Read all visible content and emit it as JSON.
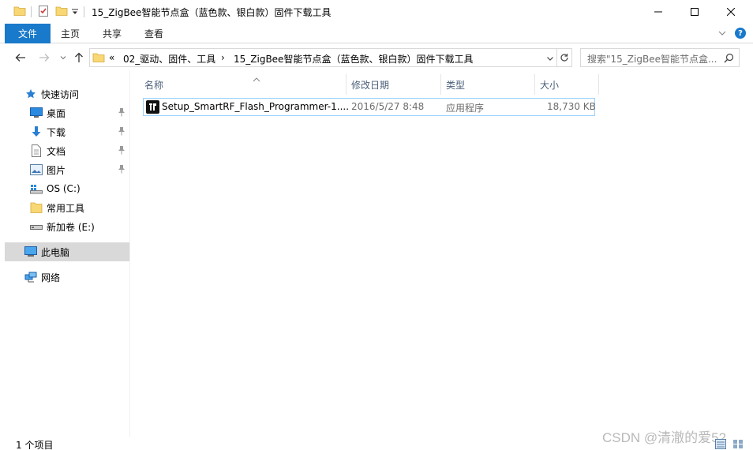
{
  "window": {
    "title": "15_ZigBee智能节点盒（蓝色款、银白款）固件下载工具"
  },
  "ribbon": {
    "tabs": [
      {
        "label": "文件"
      },
      {
        "label": "主页"
      },
      {
        "label": "共享"
      },
      {
        "label": "查看"
      }
    ],
    "help": "?"
  },
  "address": {
    "overflow": "«",
    "path": [
      {
        "label": "02_驱动、固件、工具"
      },
      {
        "label": "15_ZigBee智能节点盒（蓝色款、银白款）固件下载工具"
      }
    ],
    "search_placeholder": "搜索\"15_ZigBee智能节点盒..."
  },
  "navigation": {
    "quick_access": "快速访问",
    "items": [
      {
        "label": "桌面",
        "icon": "desktop-icon",
        "pinned": true
      },
      {
        "label": "下载",
        "icon": "download-icon",
        "pinned": true
      },
      {
        "label": "文档",
        "icon": "document-icon",
        "pinned": true
      },
      {
        "label": "图片",
        "icon": "picture-icon",
        "pinned": true
      },
      {
        "label": "OS (C:)",
        "icon": "drive-icon",
        "pinned": false
      },
      {
        "label": "常用工具",
        "icon": "folder-icon",
        "pinned": false
      },
      {
        "label": "新加卷 (E:)",
        "icon": "drive-icon",
        "pinned": false
      }
    ],
    "this_pc": "此电脑",
    "network": "网络"
  },
  "file_list": {
    "columns": [
      {
        "label": "名称"
      },
      {
        "label": "修改日期"
      },
      {
        "label": "类型"
      },
      {
        "label": "大小"
      }
    ],
    "rows": [
      {
        "name": "Setup_SmartRF_Flash_Programmer-1....",
        "modified": "2016/5/27 8:48",
        "type": "应用程序",
        "size": "18,730 KB",
        "icon": "ti-installer-icon"
      }
    ]
  },
  "status": {
    "item_count": "1 个项目",
    "watermark": "CSDN @清澈的爱52"
  },
  "colors": {
    "accent": "#1979ca",
    "selection_border": "#99d1ff",
    "nav_selected": "#d9d9d9",
    "header_text": "#4c607a"
  }
}
